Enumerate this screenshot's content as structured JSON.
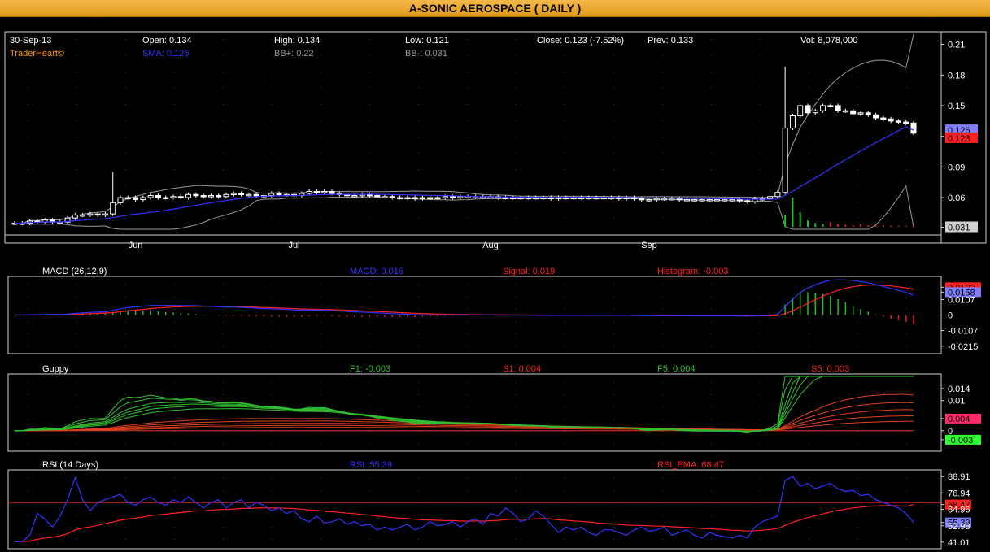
{
  "title": "A-SONIC AEROSPACE ( DAILY )",
  "colors": {
    "background": "#000000",
    "up": "#ffffff",
    "sma": "#3333ff",
    "bb": "#9a9a9a",
    "macd": "#3333ff",
    "signal": "#ff2020",
    "hist_pos": "#20c020",
    "hist_neg": "#e02020",
    "fast": "#30c030",
    "slow": "#e04020",
    "rsi": "#3333ff",
    "rsi_ema": "#ff2020"
  },
  "info": {
    "date": "30-Sep-13",
    "brand": "TraderHeart©",
    "open": "Open: 0.134",
    "high": "High: 0.134",
    "low": "Low: 0.121",
    "close": "Close: 0.123 (-7.52%)",
    "prev": "Prev: 0.133",
    "vol": "Vol: 8,078,000",
    "sma": "SMA: 0.126",
    "bbplus": "BB+: 0.22",
    "bbminus": "BB-: 0.031"
  },
  "macd_labels": {
    "name": "MACD (26,12,9)",
    "macd": "MACD: 0.016",
    "signal": "Signal: 0.019",
    "hist": "Histogram: -0.003"
  },
  "guppy_labels": {
    "name": "Guppy",
    "f1": "F1: -0.003",
    "s1": "S1: 0.004",
    "f5": "F5: 0.004",
    "s5": "S5: 0.003"
  },
  "rsi_labels": {
    "name": "RSI (14 Days)",
    "rsi": "RSI: 55.39",
    "ema": "RSI_EMA: 68.47"
  },
  "chart_data": [
    {
      "panel": "price",
      "type": "candlestick",
      "x_ticks": [
        "Jun",
        "Jul",
        "Aug",
        "Sep"
      ],
      "y_ticks": [
        "0.21",
        "0.18",
        "0.15",
        "0.12",
        "0.09",
        "0.06",
        "0.031"
      ],
      "ylim": [
        0.029,
        0.22
      ],
      "right_tags": [
        {
          "text": "0.126",
          "color": "#8080ff"
        },
        {
          "text": "0.123",
          "color": "#ff2020"
        },
        {
          "text": "0.031",
          "color": "#d0d0d0"
        }
      ],
      "close": [
        0.035,
        0.035,
        0.037,
        0.036,
        0.038,
        0.036,
        0.036,
        0.04,
        0.043,
        0.043,
        0.044,
        0.043,
        0.044,
        0.055,
        0.06,
        0.06,
        0.058,
        0.06,
        0.062,
        0.06,
        0.06,
        0.061,
        0.06,
        0.063,
        0.062,
        0.061,
        0.062,
        0.061,
        0.063,
        0.064,
        0.063,
        0.063,
        0.062,
        0.062,
        0.064,
        0.063,
        0.063,
        0.062,
        0.064,
        0.066,
        0.065,
        0.066,
        0.064,
        0.063,
        0.062,
        0.062,
        0.063,
        0.062,
        0.061,
        0.061,
        0.06,
        0.06,
        0.06,
        0.059,
        0.06,
        0.06,
        0.06,
        0.061,
        0.06,
        0.061,
        0.061,
        0.061,
        0.061,
        0.061,
        0.06,
        0.06,
        0.06,
        0.06,
        0.06,
        0.06,
        0.06,
        0.059,
        0.06,
        0.06,
        0.06,
        0.06,
        0.06,
        0.06,
        0.06,
        0.06,
        0.059,
        0.06,
        0.059,
        0.058,
        0.058,
        0.059,
        0.059,
        0.059,
        0.058,
        0.058,
        0.058,
        0.058,
        0.058,
        0.058,
        0.058,
        0.058,
        0.057,
        0.056,
        0.059,
        0.059,
        0.061,
        0.065,
        0.128,
        0.14,
        0.15,
        0.143,
        0.145,
        0.15,
        0.15,
        0.145,
        0.145,
        0.142,
        0.143,
        0.141,
        0.138,
        0.137,
        0.135,
        0.134,
        0.133,
        0.123
      ],
      "sma_last": 0.126,
      "bb_upper_last": 0.22,
      "bb_lower_last": 0.031,
      "volume": {
        "ylim": [
          0,
          1
        ],
        "values_recent": [
          0.25,
          0.6,
          0.3,
          0.13,
          0.08,
          0.06,
          0.1,
          0.05,
          0.04,
          0.03,
          0.05,
          0.03,
          0.03,
          0.03,
          0.02,
          0.02,
          0.02,
          0.02
        ]
      }
    },
    {
      "panel": "macd",
      "type": "line",
      "y_ticks": [
        "0.0192",
        "0.0158",
        "0.0107",
        "0",
        "-0.0107",
        "-0.0215"
      ],
      "ylim": [
        -0.025,
        0.025
      ],
      "series": [
        {
          "name": "MACD",
          "last": 0.016
        },
        {
          "name": "Signal",
          "last": 0.019
        },
        {
          "name": "Histogram",
          "last": -0.003
        }
      ]
    },
    {
      "panel": "guppy",
      "type": "line",
      "y_ticks": [
        "0.014",
        "0.01",
        "0.004",
        "0",
        "-0.003"
      ],
      "ylim": [
        -0.006,
        0.018
      ],
      "series": [
        {
          "name": "F1",
          "last": -0.003
        },
        {
          "name": "S1",
          "last": 0.004
        },
        {
          "name": "F5",
          "last": 0.004
        },
        {
          "name": "S5",
          "last": 0.003
        }
      ]
    },
    {
      "panel": "rsi",
      "type": "line",
      "y_ticks": [
        "88.91",
        "76.94",
        "68.47",
        "64.96",
        "55.39",
        "52.98",
        "41.01"
      ],
      "ylim": [
        38,
        92
      ],
      "overbought": 70,
      "rsi": [
        41.5,
        41.5,
        46,
        62,
        58,
        52,
        60,
        72,
        88,
        72,
        64,
        70,
        72,
        74,
        76,
        70,
        68,
        72,
        74,
        70,
        68,
        72,
        70,
        74,
        70,
        66,
        70,
        72,
        66,
        70,
        72,
        66,
        70,
        68,
        64,
        66,
        62,
        64,
        58,
        56,
        60,
        55,
        56,
        58,
        54,
        56,
        53,
        54,
        50,
        52,
        50,
        52,
        54,
        50,
        52,
        56,
        53,
        54,
        56,
        52,
        56,
        58,
        54,
        62,
        60,
        66,
        62,
        56,
        58,
        64,
        60,
        54,
        48,
        52,
        50,
        52,
        48,
        46,
        50,
        50,
        48,
        46,
        50,
        52,
        49,
        50,
        52,
        46,
        48,
        50,
        46,
        44,
        48,
        46,
        45,
        44,
        46,
        44,
        52,
        56,
        58,
        60,
        86,
        89,
        82,
        84,
        80,
        82,
        84,
        80,
        78,
        79,
        75,
        76,
        72,
        70,
        68,
        66,
        62,
        55.39
      ],
      "rsi_ema_last": 68.47
    }
  ]
}
